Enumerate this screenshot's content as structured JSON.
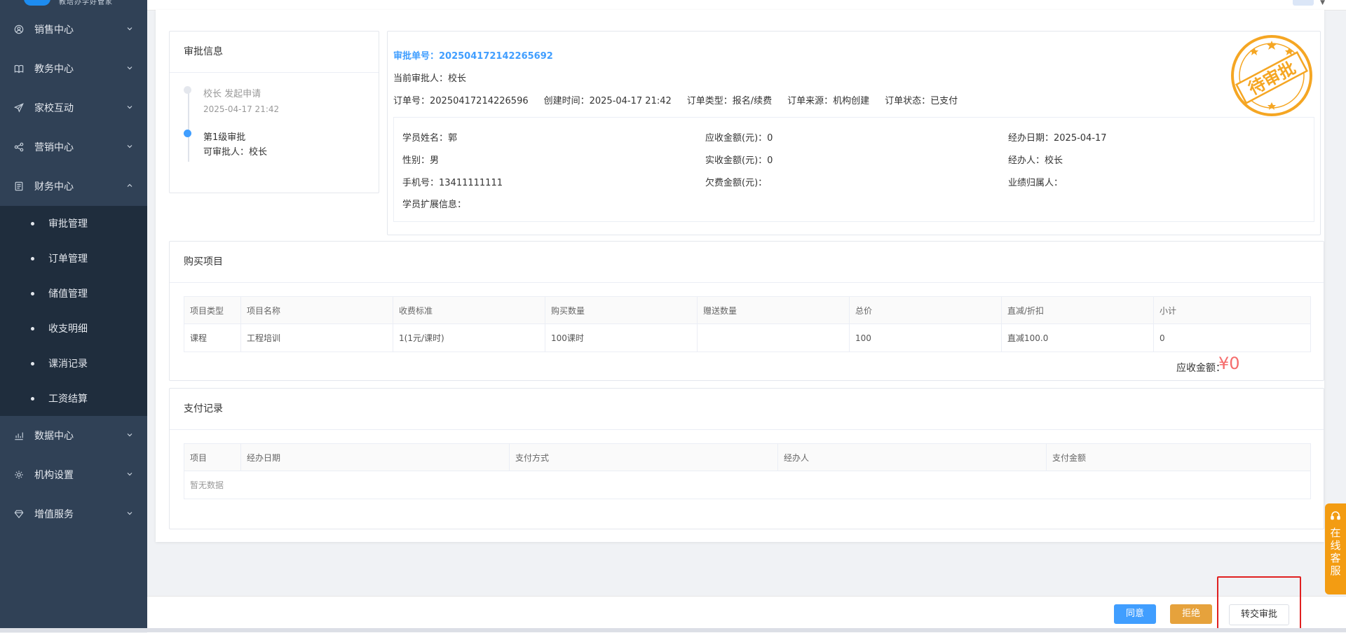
{
  "brand": {
    "tagline": "教培办学好管家"
  },
  "sidebar": {
    "menus": [
      {
        "label": "销售中心",
        "icon": "user-target-icon"
      },
      {
        "label": "教务中心",
        "icon": "book-icon"
      },
      {
        "label": "家校互动",
        "icon": "paper-plane-icon"
      },
      {
        "label": "营销中心",
        "icon": "share-icon"
      },
      {
        "label": "财务中心",
        "icon": "ledger-icon",
        "expanded": true
      },
      {
        "label": "数据中心",
        "icon": "bar-chart-icon"
      },
      {
        "label": "机构设置",
        "icon": "gear-icon"
      },
      {
        "label": "增值服务",
        "icon": "diamond-icon"
      }
    ],
    "finance_sub": [
      "审批管理",
      "订单管理",
      "储值管理",
      "收支明细",
      "课消记录",
      "工资结算"
    ]
  },
  "approval": {
    "title": "审批信息",
    "step1_title": "校长 发起申请",
    "step1_time": "2025-04-17 21:42",
    "step2_title": "第1级审批",
    "step2_approver": "可审批人：校长"
  },
  "order": {
    "approval_no": "审批单号：202504172142265692",
    "current_approver": "当前审批人：校长",
    "order_no": "订单号：20250417214226596",
    "created": "创建时间：2025-04-17 21:42",
    "order_type": "订单类型：报名/续费",
    "order_source": "订单来源：机构创建",
    "order_status": "订单状态：已支付",
    "student_name": "学员姓名：郭",
    "gender": "性别：男",
    "phone": "手机号：13411111111",
    "ext_info": "学员扩展信息：",
    "receivable": "应收金额(元)：0",
    "received": "实收金额(元)：0",
    "arrears": "欠费金额(元)：",
    "date": "经办日期：2025-04-17",
    "handler": "经办人：校长",
    "performance": "业绩归属人：",
    "stamp": "待审批",
    "stamp_color": "#f5a623"
  },
  "purchase": {
    "title": "购买项目",
    "headers": [
      "项目类型",
      "项目名称",
      "收费标准",
      "购买数量",
      "赠送数量",
      "总价",
      "直减/折扣",
      "小计"
    ],
    "rows": [
      [
        "课程",
        "工程培训",
        "1(1元/课时)",
        "100课时",
        "",
        "100",
        "直减100.0",
        "0"
      ]
    ],
    "total_label": "应收金额：",
    "total_value": "¥0"
  },
  "payment": {
    "title": "支付记录",
    "headers": [
      "项目",
      "经办日期",
      "支付方式",
      "经办人",
      "支付金额"
    ],
    "empty": "暂无数据"
  },
  "footer": {
    "agree": "同意",
    "reject": "拒绝",
    "transfer": "转交审批"
  },
  "service": {
    "label": "在线客服"
  }
}
